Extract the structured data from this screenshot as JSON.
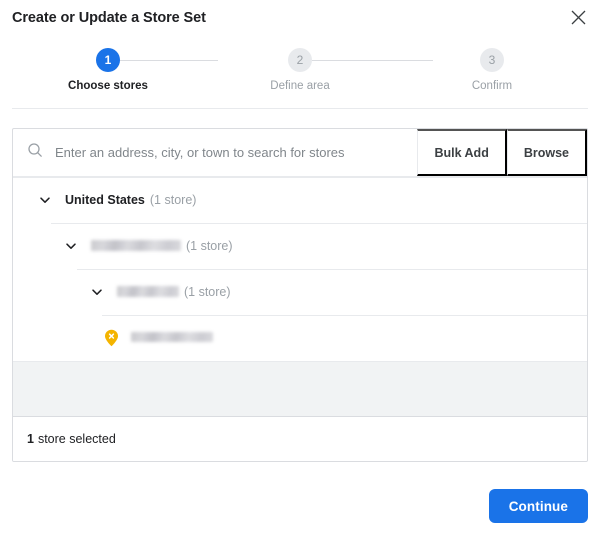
{
  "dialog": {
    "title": "Create or Update a Store Set",
    "close_icon": "close-icon"
  },
  "stepper": {
    "steps": [
      {
        "number": "1",
        "label": "Choose stores",
        "state": "active"
      },
      {
        "number": "2",
        "label": "Define area",
        "state": "upcoming"
      },
      {
        "number": "3",
        "label": "Confirm",
        "state": "upcoming"
      }
    ]
  },
  "search": {
    "icon": "search-icon",
    "value": "",
    "placeholder": "Enter an address, city, or town to search for stores",
    "bulk_add_label": "Bulk Add",
    "browse_label": "Browse"
  },
  "tree": {
    "rows": [
      {
        "level": 1,
        "icon": "chevron-down-icon",
        "name": "United States",
        "count": "(1 store)",
        "redacted": false
      },
      {
        "level": 2,
        "icon": "chevron-down-icon",
        "name": "",
        "count": "(1 store)",
        "redacted": true
      },
      {
        "level": 3,
        "icon": "chevron-down-icon",
        "name": "",
        "count": "(1 store)",
        "redacted": true
      },
      {
        "level": 4,
        "icon": "map-pin-icon",
        "name": "",
        "count": "",
        "redacted": true
      }
    ]
  },
  "card_footer": {
    "count": "1",
    "label": "store selected"
  },
  "footer": {
    "continue_label": "Continue"
  },
  "colors": {
    "accent": "#1a73e8",
    "pin": "#f4b400",
    "border": "#dadce0",
    "divider": "#e8eaed",
    "muted_text": "#9aa0a6",
    "filler_bg": "#f1f3f4"
  }
}
